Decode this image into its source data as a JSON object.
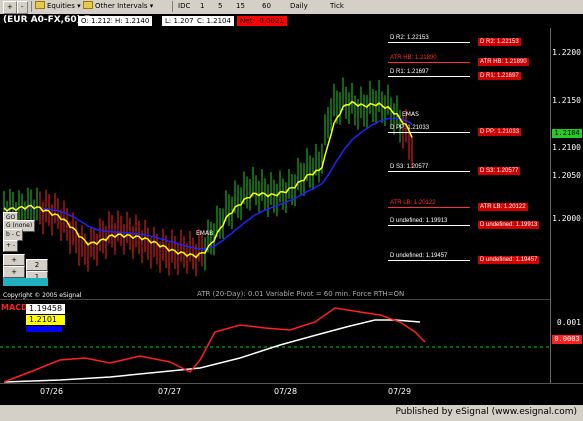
{
  "toolbar": {
    "zoom_in": "+",
    "zoom_out": "-",
    "equities": "Equities",
    "other_intervals": "Other Intervals",
    "intervals": [
      "IDC",
      "1",
      "5",
      "15",
      "60",
      "Daily",
      "Tick"
    ]
  },
  "header": {
    "symbol": "(EUR A0-FX,60) 7",
    "open": "O:  1.2125",
    "high": "H:  1.2140",
    "low": "L:  1.2075",
    "close": "C:  1.2104",
    "net": "Net:  -0.0021"
  },
  "price_axis": {
    "labels": [
      "1.2200",
      "1.2150",
      "1.2100",
      "1.2050",
      "1.2000"
    ],
    "current_price": "1.2104"
  },
  "pivots": [
    {
      "name": "D R2",
      "value": "1.22153",
      "color": "#ffffff",
      "box": "D R2: 1.22153"
    },
    {
      "name": "ATR HB",
      "value": "1.21890",
      "color": "#ff3030",
      "box": "ATR HB: 1.21890"
    },
    {
      "name": "D R1",
      "value": "1.21697",
      "color": "#ffffff",
      "box": "D R1: 1.21697"
    },
    {
      "name": "D PP",
      "value": "1.21033",
      "color": "#ffffff",
      "box": "D PP: 1.21033"
    },
    {
      "name": "D S3",
      "value": "1.20577",
      "color": "#ffffff",
      "box": "D S3: 1.20577"
    },
    {
      "name": "ATR LB",
      "value": "1.20122",
      "color": "#ff3030",
      "box": "ATR LB: 1.20122"
    },
    {
      "name": "D undefined",
      "value": "1.19913",
      "color": "#ffffff",
      "box": "D undefined: 1.19913"
    },
    {
      "name": "D undefined",
      "value": "1.19457",
      "color": "#ffffff",
      "box": "D undefined: 1.19457"
    }
  ],
  "study_info": {
    "atr_text": "ATR (20-Day): 0.01   Variable Pivot = 60 min.   Force RTH=ON",
    "copyright": "Copyright © 2005 eSignal",
    "ema_label_1": "EMAS",
    "ema_label_2": "EMAB"
  },
  "left_controls": {
    "row1": "GO",
    "row2": "G  (none)",
    "row3": "b  -  C",
    "row4": "+  -",
    "row5a": "+",
    "row5b": "2",
    "row6a": "+",
    "row6b": "1"
  },
  "macd": {
    "title": "MACD",
    "value1": "1.19458",
    "value2": "1.2101",
    "axis_value": "0.001",
    "axis_tag": "0.0003"
  },
  "x_axis": {
    "labels": [
      "07/26",
      "07/27",
      "07/28",
      "07/29"
    ]
  },
  "footer": {
    "text": "Published by eSignal (www.esignal.com)"
  },
  "colors": {
    "up_bar": "#22cc22",
    "down_bar": "#ff2222",
    "ema_fast": "#ffff00",
    "ema_slow": "#2222ff",
    "macd_line": "#ff2020",
    "signal_line": "#ffffff",
    "zero_line": "#00cc00"
  },
  "chart_data": {
    "type": "line",
    "x": [
      "07/26",
      "07/27",
      "07/28",
      "07/29"
    ],
    "series": [],
    "ylim": [
      1.194,
      1.223
    ]
  }
}
